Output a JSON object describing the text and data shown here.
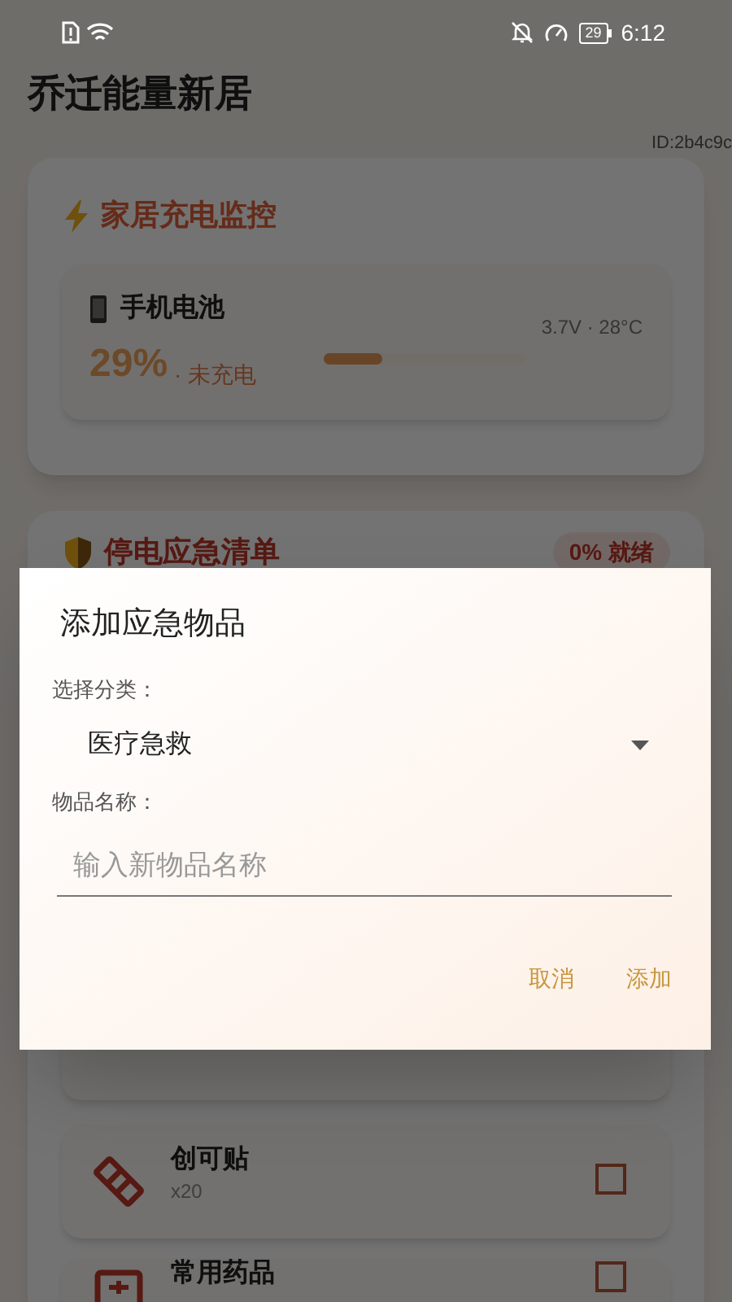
{
  "status_bar": {
    "battery": "29",
    "time": "6:12"
  },
  "app_title": "乔迁能量新居",
  "device_id": "ID:2b4c9c",
  "charging_monitor": {
    "title": "家居充电监控",
    "device": {
      "name": "手机电池",
      "percent": "29%",
      "status": "· 未充电",
      "level": 0.29,
      "reading": "3.7V · 28°C"
    }
  },
  "emergency_list": {
    "title": "停电应急清单",
    "badge": "0% 就绪",
    "items": [
      {
        "kind": "bandage",
        "name": "创可贴",
        "quantity": "x20",
        "checked": false
      },
      {
        "kind": "medicine",
        "name": "常用药品",
        "checked": false
      }
    ]
  },
  "dialog": {
    "title": "添加应急物品",
    "category_label": "选择分类：",
    "category_value": "医疗急救",
    "name_label": "物品名称：",
    "name_placeholder": "输入新物品名称",
    "buttons": [
      "取消",
      "添加"
    ]
  }
}
